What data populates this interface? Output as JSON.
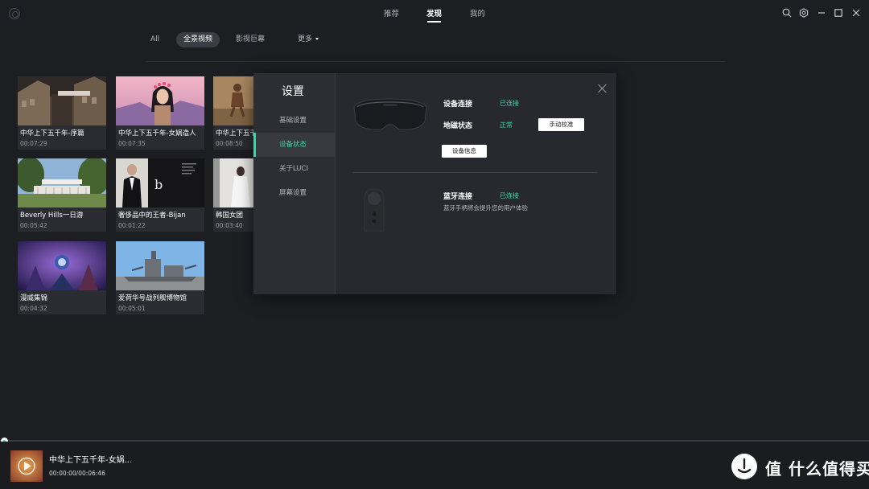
{
  "topbar": {
    "tabs": [
      "推荐",
      "发现",
      "我的"
    ],
    "active_tab": "发现"
  },
  "subtabs": {
    "items": [
      "All",
      "全景视频",
      "影视巨幕",
      "更多"
    ],
    "active": "全景视频"
  },
  "videos": [
    {
      "title": "中华上下五千年-序篇",
      "duration": "00:07:29"
    },
    {
      "title": "中华上下五千年-女娲造人",
      "duration": "00:07:35"
    },
    {
      "title": "中华上下五千年-",
      "duration": "00:08:50"
    },
    {
      "title": "Beverly Hills一日游",
      "duration": "00:05:42"
    },
    {
      "title": "奢侈品中的王者-Bijan",
      "duration": "00:01:22"
    },
    {
      "title": "韩国女团",
      "duration": "00:03:40"
    },
    {
      "title": "漫威集锦",
      "duration": "00:04:32"
    },
    {
      "title": "爱荷华号战列舰博物馆",
      "duration": "00:05:01"
    }
  ],
  "settings_dialog": {
    "title": "设置",
    "nav": [
      "基础设置",
      "设备状态",
      "关于LUCI",
      "屏幕设置"
    ],
    "active_nav": "设备状态",
    "device_connection_label": "设备连接",
    "device_connection_status": "已连接",
    "geomagnetic_label": "地磁状态",
    "geomagnetic_status": "正常",
    "calibrate_button": "手动校准",
    "device_info_button": "设备信息",
    "bluetooth_label": "蓝牙连接",
    "bluetooth_status": "已连接",
    "bluetooth_hint": "蓝牙手柄将会提升您的用户体验"
  },
  "player": {
    "now_playing_title": "中华上下五千年-女娲...",
    "time": "00:00:00/00:06:46",
    "progress": 0
  },
  "watermark": {
    "text": "值 什么值得买"
  },
  "colors": {
    "background": "#1d1e22",
    "accent": "#3fd2b0",
    "panel": "#27292e"
  }
}
